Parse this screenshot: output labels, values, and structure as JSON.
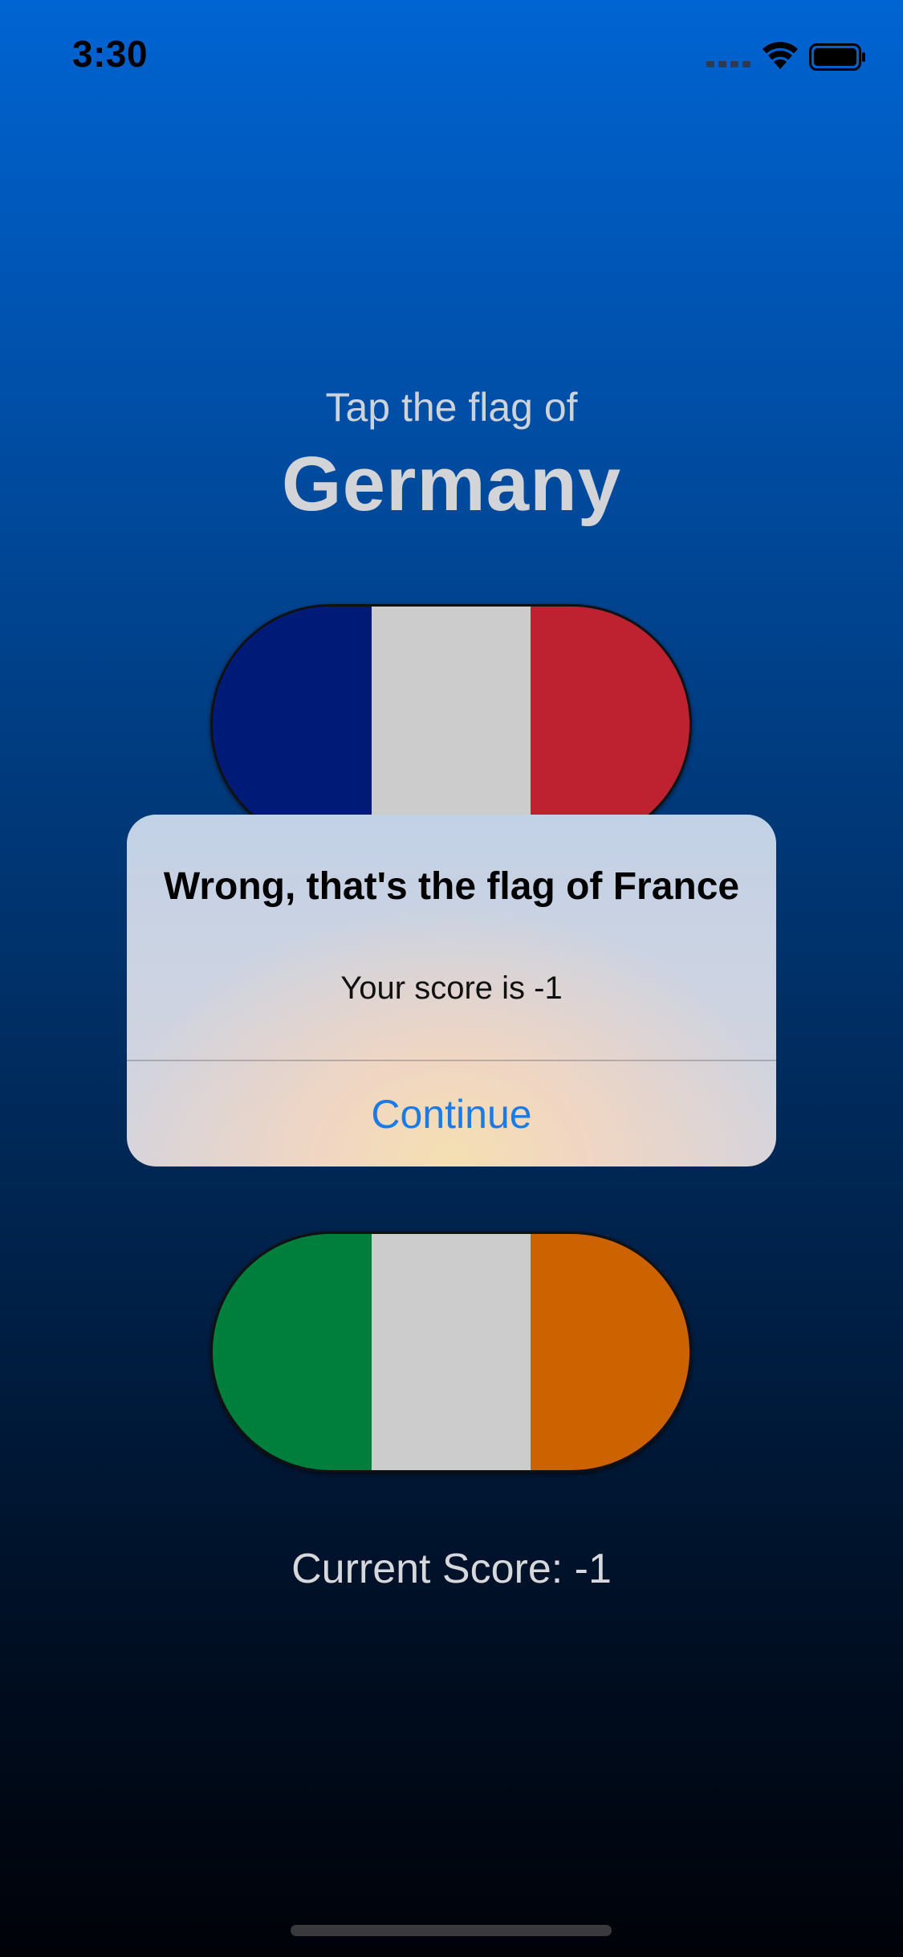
{
  "status_bar": {
    "time": "3:30",
    "icons": [
      "cellular-signal-icon",
      "wifi-icon",
      "battery-icon"
    ]
  },
  "prompt": {
    "subtitle": "Tap the flag of",
    "country": "Germany"
  },
  "flags": [
    {
      "name": "France",
      "stripes": [
        "#001a77",
        "#cccccc",
        "#be2231"
      ]
    },
    {
      "name": "Ireland",
      "stripes": [
        "#007f3c",
        "#cccccc",
        "#cc6200"
      ]
    }
  ],
  "alert": {
    "title": "Wrong, that's the flag of France",
    "message": "Your score is -1",
    "button_label": "Continue"
  },
  "score": {
    "label": "Current Score: -1"
  },
  "colors": {
    "background_top": "#0064d2",
    "background_bottom": "#000208",
    "alert_button": "#1a7ae6"
  }
}
